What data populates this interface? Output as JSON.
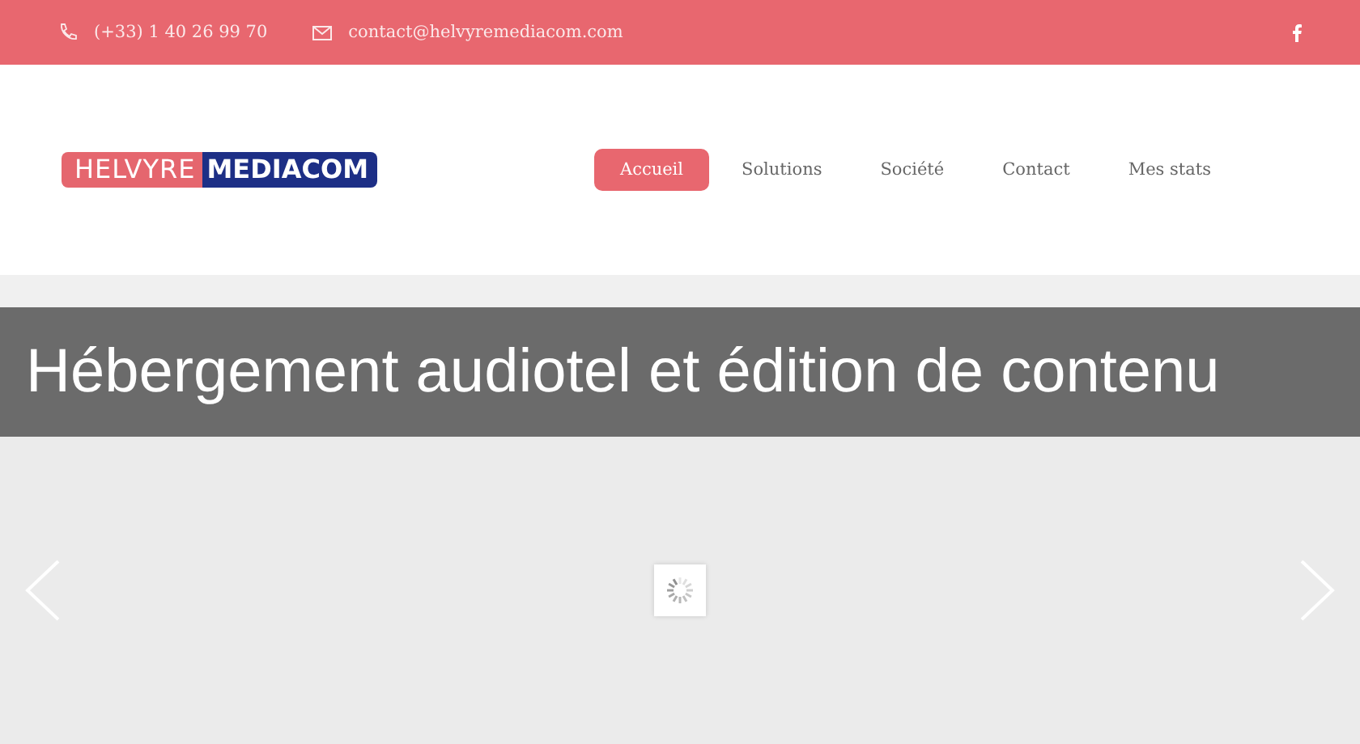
{
  "topbar": {
    "phone": "(+33) 1 40 26 99 70",
    "email": "contact@helvyremediacom.com"
  },
  "logo": {
    "part_1": "HELVYRE",
    "part_2": "MEDIACOM"
  },
  "nav": [
    {
      "label": "Accueil",
      "selected": true
    },
    {
      "label": "Solutions",
      "selected": false
    },
    {
      "label": "Société",
      "selected": false
    },
    {
      "label": "Contact",
      "selected": false
    },
    {
      "label": "Mes stats",
      "selected": false
    }
  ],
  "page_title": "Hébergement audiotel et édition de contenu"
}
